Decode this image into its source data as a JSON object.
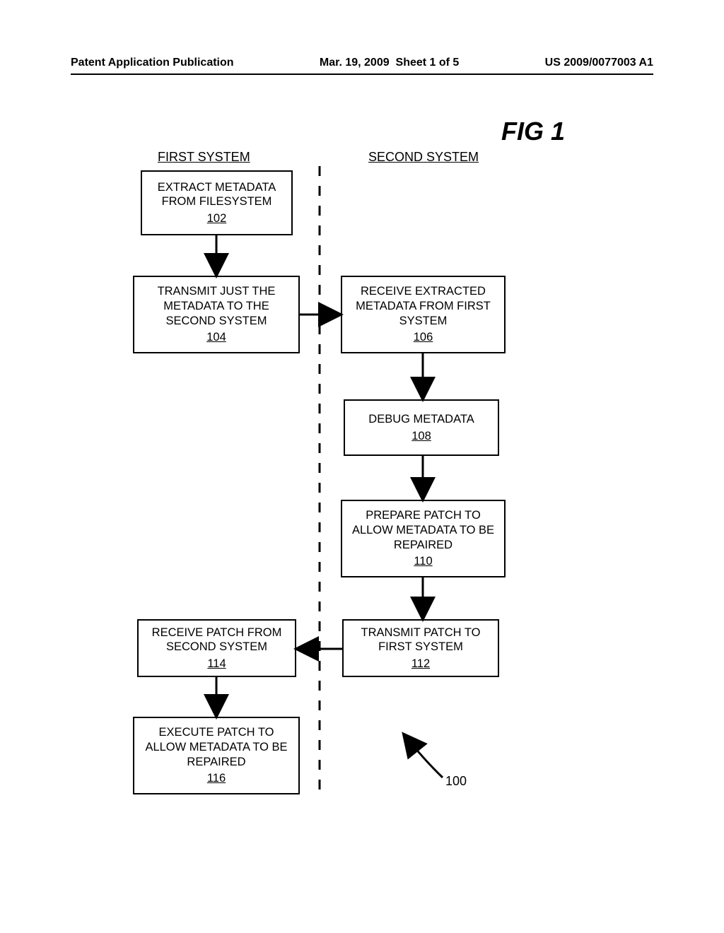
{
  "header": {
    "publication": "Patent Application Publication",
    "date": "Mar. 19, 2009",
    "sheet": "Sheet 1 of 5",
    "pubnum": "US 2009/0077003 A1"
  },
  "figure_label": "FIG 1",
  "columns": {
    "left": "FIRST SYSTEM",
    "right": "SECOND SYSTEM"
  },
  "boxes": {
    "b102": {
      "text": "EXTRACT METADATA FROM FILESYSTEM",
      "ref": "102"
    },
    "b104": {
      "text": "TRANSMIT JUST THE METADATA TO THE SECOND SYSTEM",
      "ref": "104"
    },
    "b106": {
      "text": "RECEIVE EXTRACTED METADATA FROM FIRST SYSTEM",
      "ref": "106"
    },
    "b108": {
      "text": "DEBUG METADATA",
      "ref": "108"
    },
    "b110": {
      "text": "PREPARE PATCH TO ALLOW METADATA TO BE REPAIRED",
      "ref": "110"
    },
    "b112": {
      "text": "TRANSMIT PATCH TO FIRST SYSTEM",
      "ref": "112"
    },
    "b114": {
      "text": "RECEIVE PATCH FROM SECOND SYSTEM",
      "ref": "114"
    },
    "b116": {
      "text": "EXECUTE PATCH TO ALLOW METADATA TO BE REPAIRED",
      "ref": "116"
    }
  },
  "reference_label": "100"
}
